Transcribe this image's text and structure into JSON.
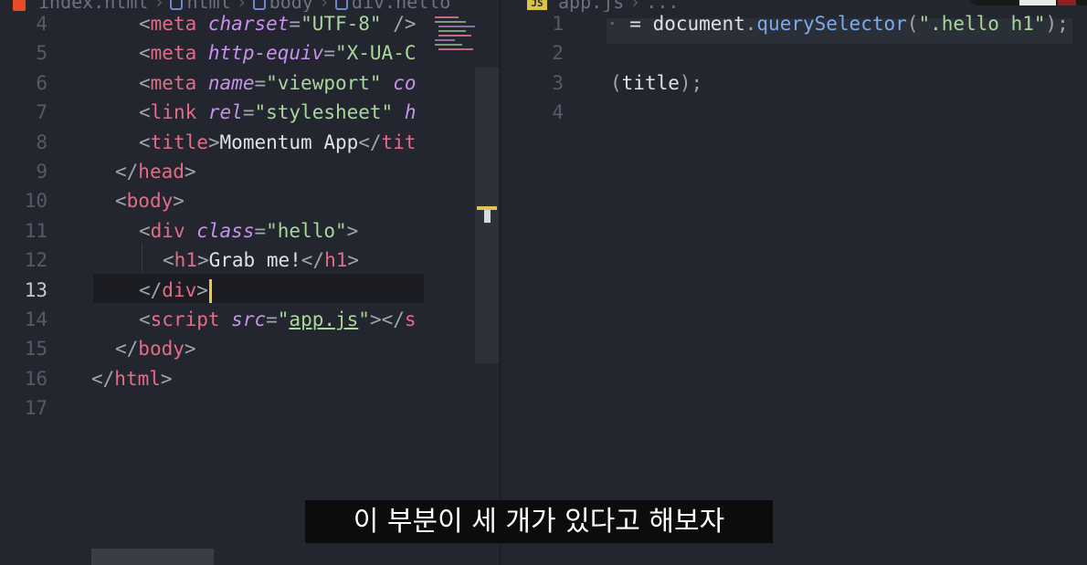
{
  "left_editor": {
    "breadcrumb": {
      "file": "index.html",
      "items": [
        "html",
        "body",
        "div.hello"
      ]
    },
    "active_line": "13",
    "lines": [
      {
        "num": "4",
        "tokens": [
          {
            "t": "<",
            "c": "t-br"
          },
          {
            "t": "meta",
            "c": "t-tag"
          },
          {
            "t": " ",
            "c": "t-txt"
          },
          {
            "t": "charset",
            "c": "t-attr"
          },
          {
            "t": "=",
            "c": "t-pun"
          },
          {
            "t": "\"UTF-8\"",
            "c": "t-str"
          },
          {
            "t": " />",
            "c": "t-br"
          }
        ]
      },
      {
        "num": "5",
        "tokens": [
          {
            "t": "<",
            "c": "t-br"
          },
          {
            "t": "meta",
            "c": "t-tag"
          },
          {
            "t": " ",
            "c": "t-txt"
          },
          {
            "t": "http-equiv",
            "c": "t-attr"
          },
          {
            "t": "=",
            "c": "t-pun"
          },
          {
            "t": "\"X-UA-C",
            "c": "t-str"
          }
        ]
      },
      {
        "num": "6",
        "tokens": [
          {
            "t": "<",
            "c": "t-br"
          },
          {
            "t": "meta",
            "c": "t-tag"
          },
          {
            "t": " ",
            "c": "t-txt"
          },
          {
            "t": "name",
            "c": "t-attr"
          },
          {
            "t": "=",
            "c": "t-pun"
          },
          {
            "t": "\"viewport\"",
            "c": "t-str"
          },
          {
            "t": " ",
            "c": "t-txt"
          },
          {
            "t": "co",
            "c": "t-attr"
          }
        ]
      },
      {
        "num": "7",
        "tokens": [
          {
            "t": "<",
            "c": "t-br"
          },
          {
            "t": "link",
            "c": "t-tag"
          },
          {
            "t": " ",
            "c": "t-txt"
          },
          {
            "t": "rel",
            "c": "t-attr"
          },
          {
            "t": "=",
            "c": "t-pun"
          },
          {
            "t": "\"stylesheet\"",
            "c": "t-str"
          },
          {
            "t": " ",
            "c": "t-txt"
          },
          {
            "t": "h",
            "c": "t-attr"
          }
        ]
      },
      {
        "num": "8",
        "tokens": [
          {
            "t": "<",
            "c": "t-br"
          },
          {
            "t": "title",
            "c": "t-tag"
          },
          {
            "t": ">",
            "c": "t-br"
          },
          {
            "t": "Momentum App",
            "c": "t-txt"
          },
          {
            "t": "</",
            "c": "t-br"
          },
          {
            "t": "tit",
            "c": "t-tag"
          }
        ]
      },
      {
        "num": "9",
        "tokens": [
          {
            "t": "</",
            "c": "t-br"
          },
          {
            "t": "head",
            "c": "t-tag"
          },
          {
            "t": ">",
            "c": "t-br"
          }
        ]
      },
      {
        "num": "10",
        "tokens": [
          {
            "t": "<",
            "c": "t-br"
          },
          {
            "t": "body",
            "c": "t-tag"
          },
          {
            "t": ">",
            "c": "t-br"
          }
        ]
      },
      {
        "num": "11",
        "tokens": [
          {
            "t": "<",
            "c": "t-br"
          },
          {
            "t": "div",
            "c": "t-tag"
          },
          {
            "t": " ",
            "c": "t-txt"
          },
          {
            "t": "class",
            "c": "t-attr"
          },
          {
            "t": "=",
            "c": "t-pun"
          },
          {
            "t": "\"hello\"",
            "c": "t-str"
          },
          {
            "t": ">",
            "c": "t-br"
          }
        ]
      },
      {
        "num": "12",
        "tokens": [
          {
            "t": "<",
            "c": "t-br"
          },
          {
            "t": "h1",
            "c": "t-tag"
          },
          {
            "t": ">",
            "c": "t-br"
          },
          {
            "t": "Grab me!",
            "c": "t-txt"
          },
          {
            "t": "</",
            "c": "t-br"
          },
          {
            "t": "h1",
            "c": "t-tag"
          },
          {
            "t": ">",
            "c": "t-br"
          }
        ]
      },
      {
        "num": "13",
        "tokens": [
          {
            "t": "</",
            "c": "t-br"
          },
          {
            "t": "div",
            "c": "t-tag"
          },
          {
            "t": ">",
            "c": "t-br"
          }
        ]
      },
      {
        "num": "14",
        "tokens": [
          {
            "t": "<",
            "c": "t-br"
          },
          {
            "t": "script",
            "c": "t-tag"
          },
          {
            "t": " ",
            "c": "t-txt"
          },
          {
            "t": "src",
            "c": "t-attr"
          },
          {
            "t": "=",
            "c": "t-pun"
          },
          {
            "t": "\"",
            "c": "t-str"
          },
          {
            "t": "app.js",
            "c": "t-str link-u"
          },
          {
            "t": "\"",
            "c": "t-str"
          },
          {
            "t": "></",
            "c": "t-br"
          },
          {
            "t": "s",
            "c": "t-tag"
          }
        ]
      },
      {
        "num": "15",
        "tokens": [
          {
            "t": "</",
            "c": "t-br"
          },
          {
            "t": "body",
            "c": "t-tag"
          },
          {
            "t": ">",
            "c": "t-br"
          }
        ]
      },
      {
        "num": "16",
        "tokens": [
          {
            "t": "</",
            "c": "t-br"
          },
          {
            "t": "html",
            "c": "t-tag"
          },
          {
            "t": ">",
            "c": "t-br"
          }
        ]
      },
      {
        "num": "17",
        "tokens": []
      }
    ]
  },
  "right_editor": {
    "breadcrumb": {
      "badge": "JS",
      "file": "app.js",
      "rest": "..."
    },
    "lines": [
      {
        "num": "1",
        "tokens": [
          {
            "t": "·",
            "c": "ws-dots"
          },
          {
            "t": " = ",
            "c": "t-txt"
          },
          {
            "t": "document",
            "c": "t-txt"
          },
          {
            "t": ".",
            "c": "t-pun"
          },
          {
            "t": "querySelector",
            "c": "t-prop"
          },
          {
            "t": "(",
            "c": "t-pun"
          },
          {
            "t": "\".hello h1\"",
            "c": "t-str"
          },
          {
            "t": ");",
            "c": "t-pun"
          }
        ]
      },
      {
        "num": "2",
        "tokens": []
      },
      {
        "num": "3",
        "tokens": [
          {
            "t": "(",
            "c": "t-pun"
          },
          {
            "t": "title",
            "c": "t-txt"
          },
          {
            "t": ");",
            "c": "t-pun"
          }
        ]
      },
      {
        "num": "4",
        "tokens": []
      }
    ]
  },
  "subtitle": "이 부분이 세 개가 있다고 해보자",
  "colors": {
    "background": "#23262e",
    "tag": "#e16d86",
    "attribute": "#c792ea",
    "string": "#a7d89a",
    "method": "#7ea9ea",
    "cursor": "#f4c542"
  }
}
